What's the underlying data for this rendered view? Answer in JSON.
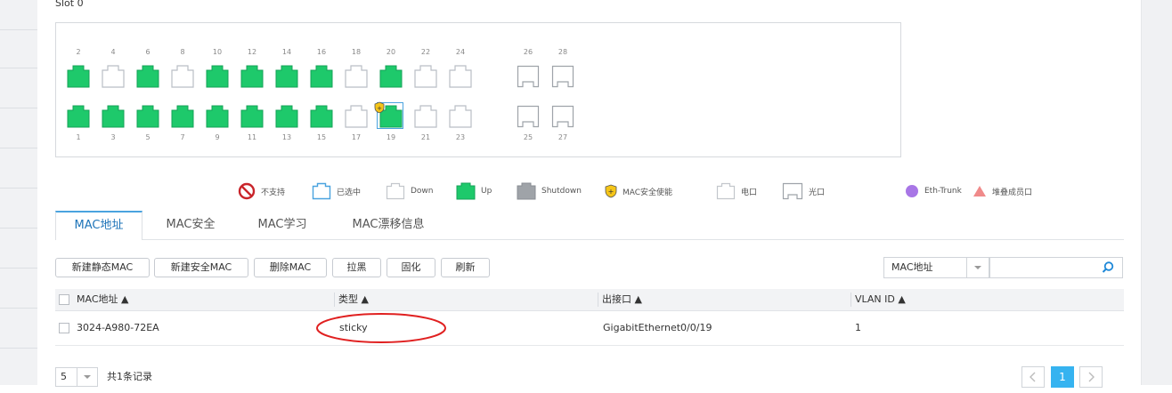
{
  "slot": {
    "title": "Slot 0"
  },
  "ports": {
    "top_row": [
      {
        "num": "2",
        "state": "up"
      },
      {
        "num": "4",
        "state": "down"
      },
      {
        "num": "6",
        "state": "up"
      },
      {
        "num": "8",
        "state": "down"
      },
      {
        "num": "10",
        "state": "up"
      },
      {
        "num": "12",
        "state": "up"
      },
      {
        "num": "14",
        "state": "up"
      },
      {
        "num": "16",
        "state": "up"
      },
      {
        "num": "18",
        "state": "down"
      },
      {
        "num": "20",
        "state": "up"
      },
      {
        "num": "22",
        "state": "down"
      },
      {
        "num": "24",
        "state": "down"
      },
      {
        "num": "26",
        "state": "fiber"
      },
      {
        "num": "28",
        "state": "fiber"
      }
    ],
    "bottom_row": [
      {
        "num": "1",
        "state": "up"
      },
      {
        "num": "3",
        "state": "up"
      },
      {
        "num": "5",
        "state": "up"
      },
      {
        "num": "7",
        "state": "up"
      },
      {
        "num": "9",
        "state": "up"
      },
      {
        "num": "11",
        "state": "up"
      },
      {
        "num": "13",
        "state": "up"
      },
      {
        "num": "15",
        "state": "up"
      },
      {
        "num": "17",
        "state": "down"
      },
      {
        "num": "19",
        "state": "up-selected-mac"
      },
      {
        "num": "21",
        "state": "down"
      },
      {
        "num": "23",
        "state": "down"
      },
      {
        "num": "25",
        "state": "fiber"
      },
      {
        "num": "27",
        "state": "fiber"
      }
    ]
  },
  "legend": {
    "unsupported": "不支持",
    "selected": "已选中",
    "down": "Down",
    "up": "Up",
    "shutdown": "Shutdown",
    "mac_security": "MAC安全使能",
    "electric": "电口",
    "optical": "光口",
    "eth_trunk": "Eth-Trunk",
    "stack_member": "堆叠成员口"
  },
  "tabs": [
    "MAC地址",
    "MAC安全",
    "MAC学习",
    "MAC漂移信息"
  ],
  "toolbar": {
    "new_static": "新建静态MAC",
    "new_secure": "新建安全MAC",
    "delete": "删除MAC",
    "blacklist": "拉黑",
    "solidify": "固化",
    "refresh": "刷新"
  },
  "filter": {
    "selected": "MAC地址",
    "search_value": ""
  },
  "table": {
    "headers": [
      "MAC地址 ▲",
      "类型 ▲",
      "出接口 ▲",
      "VLAN ID ▲"
    ],
    "rows": [
      {
        "mac": "3024-A980-72EA",
        "type": "sticky",
        "iface": "GigabitEthernet0/0/19",
        "vlan": "1"
      }
    ]
  },
  "pager": {
    "page_size": "5",
    "records": "共1条记录",
    "current_page": "1"
  },
  "colors": {
    "port_up": "#1ec96b",
    "port_down_border": "#b9bec5",
    "accent": "#36b3f0",
    "annotation": "#e02020"
  }
}
